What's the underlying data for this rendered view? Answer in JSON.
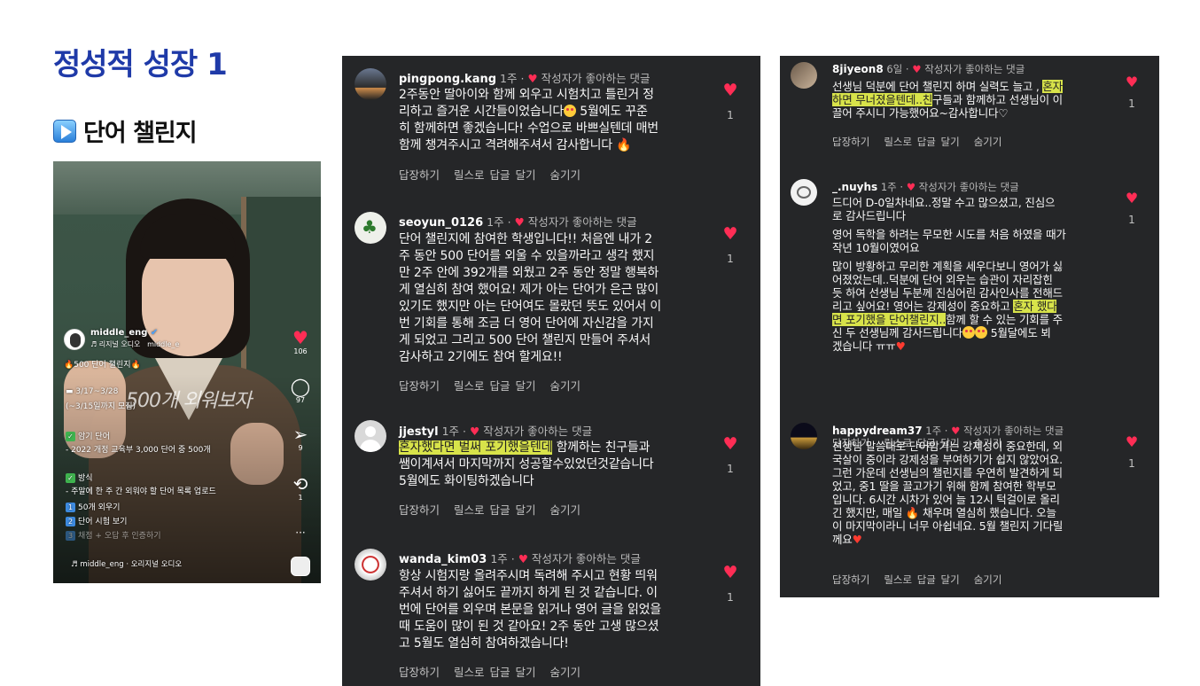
{
  "title": "정성적 성장 1",
  "subtitle": "단어 챌린지",
  "reel": {
    "username": "middle_eng",
    "audio_label": "리지널 오디오",
    "audio_label2": "middle_e",
    "challenge_line": "500 단어 챌린지",
    "date_line": "3/17~3/28",
    "date_sub": "(~3/15일까지 모집)",
    "overlay_text": "500개 외워보자",
    "memorize_title": "암기 단어",
    "memorize_desc": "- 2022 개정 교육부 3,000 단어 중 500개",
    "method_title": "방식",
    "method_desc": "- 주말에 한 주 간 외워야 할 단어 목록 업로드",
    "step1": "50개 외우기",
    "step2": "단어 시험 보기",
    "step3": "채점 + 오답 후 인증하기",
    "footer_audio": "middle_eng · 오리지널 오디오",
    "likes": "106",
    "comments": "97",
    "shares": "9",
    "reposts": "1",
    "more": "···"
  },
  "panel_middle": [
    {
      "user": "pingpong.kang",
      "time": "1주",
      "liked": "작성자가 좋아하는 댓글",
      "lines": [
        "2주동안 딸아이와 함께 외우고 시험치고 틀린거 정",
        "리하고 즐거운 시간들이었습니다",
        " 5월에도 꾸준",
        "히 함께하면 좋겠습니다! 수업으로 바쁘실텐데 매번",
        "함께 챙겨주시고 격려해주셔서 감사합니다"
      ],
      "like_count": "1",
      "reply": "답장하기",
      "reel_reply": "릴스로 답글 달기",
      "hide": "숨기기"
    },
    {
      "user": "seoyun_0126",
      "time": "1주",
      "liked": "작성자가 좋아하는 댓글",
      "lines": [
        "단어 챌린지에 참여한 학생입니다!! 처음엔 내가 2",
        "주 동안 500 단어를 외울 수 있을까라고 생각 했지",
        "만 2주 안에 392개를 외웠고 2주 동안 정말 행복하",
        "게 열심히 참여 했어요! 제가 아는 단어가 은근 많이",
        "있기도 했지만 아는 단어여도 몰랐던 뜻도 있어서 이",
        "번 기회를 통해 조금 더 영어 단어에 자신감을 가지",
        "게 되었고 그리고 500 단어 챌린지 만들어 주셔서",
        "감사하고 2기에도 참여 할게요!!"
      ],
      "like_count": "1",
      "reply": "답장하기",
      "reel_reply": "릴스로 답글 달기",
      "hide": "숨기기"
    },
    {
      "user": "jjestyl",
      "time": "1주",
      "liked": "작성자가 좋아하는 댓글",
      "highlight": "혼자했다면 벌써 포기했을텐데",
      "line1_rest": " 함께하는 친구들과",
      "lines": [
        "쌤이계셔서 마지막까지 성공할수있었던것같습니다",
        "5월에도 화이팅하겠습니다"
      ],
      "like_count": "1",
      "reply": "답장하기",
      "reel_reply": "릴스로 답글 달기",
      "hide": "숨기기"
    },
    {
      "user": "wanda_kim03",
      "time": "1주",
      "liked": "작성자가 좋아하는 댓글",
      "lines": [
        "항상 시험지랑 올려주시며 독려해 주시고 현황 띄워",
        "주셔서 하기 싫어도 끝까지 하게 된 것 같습니다. 이",
        "번에 단어를 외우며 본문을 읽거나 영어 글을 읽었을",
        "때 도움이 많이 된 것 같아요! 2주 동안 고생 많으셨",
        "고 5월도 열심히 참여하겠습니다!"
      ],
      "like_count": "1",
      "reply": "답장하기",
      "reel_reply": "릴스로 답글 달기",
      "hide": "숨기기"
    }
  ],
  "panel_right": [
    {
      "user": "8jiyeon8",
      "time": "6일",
      "liked": "작성자가 좋아하는 댓글",
      "l1a": "선생님 덕분에 단어 챌린지 하며 실력도 늘고 ,",
      "l1hl": "혼자",
      "l2hl": "하면 무너졌을텐데..친",
      "l2b": "구들과 함께하고 선생님이 이",
      "l3": "끌어 주시니 가능했어요~감사합니다♡",
      "like_count": "1",
      "reply": "답장하기",
      "reel_reply": "릴스로 답글 달기",
      "hide": "숨기기"
    },
    {
      "user": "_.nuyhs",
      "time": "1주",
      "liked": "작성자가 좋아하는 댓글",
      "p1": [
        "드디어 D-0일차네요..정말 수고 많으셨고, 진심으",
        "로 감사드립니다"
      ],
      "p2": [
        "영어 독학을 하려는 무모한 시도를 처음 하였을 때가",
        "작년 10월이였어요"
      ],
      "p3": [
        "많이 방황하고 무리한 계획을 세우다보니 영어가 싫",
        "어졌었는데..덕분에 단어 외우는 습관이 자리잡힌",
        "듯 하여 선생님 두분께 진심어린 감사인사를 전해드"
      ],
      "p3_l4a": "리고 싶어요! 영어는 강제성이 중요하고 ",
      "p3_l4hl": "혼자 했다",
      "p3_l5hl": "면 포기했을 단어챌린지..",
      "p3_l5b": "함께 할 수 있는 기회를 주",
      "p3_l6": "신 두 선생님께 감사드립니다",
      "p3_l6b": " 5월달에도 뵈",
      "p3_l7": "겠습니다 ㅠㅠ",
      "like_count": "1",
      "reply": "답장하기",
      "reel_reply": "릴스로 답글 달기",
      "hide": "숨기기"
    },
    {
      "user": "happydream37",
      "time": "1주",
      "liked": "작성자가 좋아하는 댓글",
      "lines": [
        "선생님 말씀대로 단어암기는 강제성이 중요한데, 외",
        "국살이 중이라 강제성을 부여하기가 쉽지 않았어요.",
        "그런 가운데 선생님의 챌린지를 우연히 발견하게 되",
        "었고, 중1 딸을 끌고가기 위해 함께 참여한 학부모",
        "입니다. 6시간 시차가 있어 늘 12시 턱걸이로 올리",
        "긴 했지만, 매일",
        " 채우며 열심히 했습니다. 오늘",
        "이 마지막이라니 너무 아쉽네요. 5월 챌린지 기다릴",
        "께요"
      ],
      "like_count": "1",
      "reply": "답장하기",
      "reel_reply": "릴스로 답글 달기",
      "hide": "숨기기"
    }
  ]
}
